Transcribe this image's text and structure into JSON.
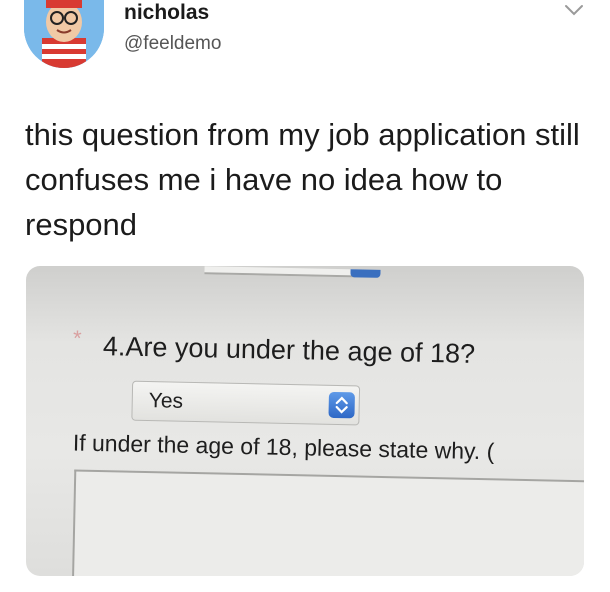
{
  "header": {
    "display_name": "nicholas",
    "handle": "@feeldemo",
    "menu_icon": "chevron-down-icon",
    "avatar_icon": "waldo-avatar"
  },
  "tweet": {
    "text": "this question from my job application still confuses me i have no idea how to respond"
  },
  "photo": {
    "required_mark": "*",
    "question": "4.Are you under the age of 18?",
    "select": {
      "selected_value": "Yes",
      "button_icon": "select-arrows-icon"
    },
    "instruction": "If under the age of 18, please state why. (",
    "colors": {
      "select_button": "#2e68c6",
      "required_star": "#d9a0a0"
    }
  }
}
